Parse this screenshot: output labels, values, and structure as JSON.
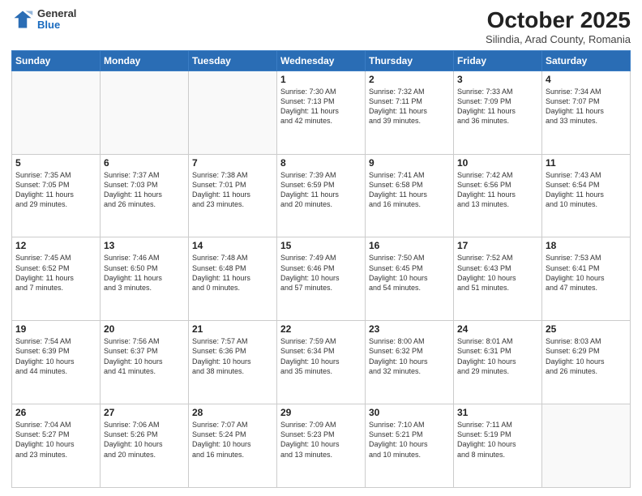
{
  "header": {
    "logo_general": "General",
    "logo_blue": "Blue",
    "month_title": "October 2025",
    "subtitle": "Silindia, Arad County, Romania"
  },
  "weekdays": [
    "Sunday",
    "Monday",
    "Tuesday",
    "Wednesday",
    "Thursday",
    "Friday",
    "Saturday"
  ],
  "weeks": [
    [
      {
        "day": "",
        "info": ""
      },
      {
        "day": "",
        "info": ""
      },
      {
        "day": "",
        "info": ""
      },
      {
        "day": "1",
        "info": "Sunrise: 7:30 AM\nSunset: 7:13 PM\nDaylight: 11 hours\nand 42 minutes."
      },
      {
        "day": "2",
        "info": "Sunrise: 7:32 AM\nSunset: 7:11 PM\nDaylight: 11 hours\nand 39 minutes."
      },
      {
        "day": "3",
        "info": "Sunrise: 7:33 AM\nSunset: 7:09 PM\nDaylight: 11 hours\nand 36 minutes."
      },
      {
        "day": "4",
        "info": "Sunrise: 7:34 AM\nSunset: 7:07 PM\nDaylight: 11 hours\nand 33 minutes."
      }
    ],
    [
      {
        "day": "5",
        "info": "Sunrise: 7:35 AM\nSunset: 7:05 PM\nDaylight: 11 hours\nand 29 minutes."
      },
      {
        "day": "6",
        "info": "Sunrise: 7:37 AM\nSunset: 7:03 PM\nDaylight: 11 hours\nand 26 minutes."
      },
      {
        "day": "7",
        "info": "Sunrise: 7:38 AM\nSunset: 7:01 PM\nDaylight: 11 hours\nand 23 minutes."
      },
      {
        "day": "8",
        "info": "Sunrise: 7:39 AM\nSunset: 6:59 PM\nDaylight: 11 hours\nand 20 minutes."
      },
      {
        "day": "9",
        "info": "Sunrise: 7:41 AM\nSunset: 6:58 PM\nDaylight: 11 hours\nand 16 minutes."
      },
      {
        "day": "10",
        "info": "Sunrise: 7:42 AM\nSunset: 6:56 PM\nDaylight: 11 hours\nand 13 minutes."
      },
      {
        "day": "11",
        "info": "Sunrise: 7:43 AM\nSunset: 6:54 PM\nDaylight: 11 hours\nand 10 minutes."
      }
    ],
    [
      {
        "day": "12",
        "info": "Sunrise: 7:45 AM\nSunset: 6:52 PM\nDaylight: 11 hours\nand 7 minutes."
      },
      {
        "day": "13",
        "info": "Sunrise: 7:46 AM\nSunset: 6:50 PM\nDaylight: 11 hours\nand 3 minutes."
      },
      {
        "day": "14",
        "info": "Sunrise: 7:48 AM\nSunset: 6:48 PM\nDaylight: 11 hours\nand 0 minutes."
      },
      {
        "day": "15",
        "info": "Sunrise: 7:49 AM\nSunset: 6:46 PM\nDaylight: 10 hours\nand 57 minutes."
      },
      {
        "day": "16",
        "info": "Sunrise: 7:50 AM\nSunset: 6:45 PM\nDaylight: 10 hours\nand 54 minutes."
      },
      {
        "day": "17",
        "info": "Sunrise: 7:52 AM\nSunset: 6:43 PM\nDaylight: 10 hours\nand 51 minutes."
      },
      {
        "day": "18",
        "info": "Sunrise: 7:53 AM\nSunset: 6:41 PM\nDaylight: 10 hours\nand 47 minutes."
      }
    ],
    [
      {
        "day": "19",
        "info": "Sunrise: 7:54 AM\nSunset: 6:39 PM\nDaylight: 10 hours\nand 44 minutes."
      },
      {
        "day": "20",
        "info": "Sunrise: 7:56 AM\nSunset: 6:37 PM\nDaylight: 10 hours\nand 41 minutes."
      },
      {
        "day": "21",
        "info": "Sunrise: 7:57 AM\nSunset: 6:36 PM\nDaylight: 10 hours\nand 38 minutes."
      },
      {
        "day": "22",
        "info": "Sunrise: 7:59 AM\nSunset: 6:34 PM\nDaylight: 10 hours\nand 35 minutes."
      },
      {
        "day": "23",
        "info": "Sunrise: 8:00 AM\nSunset: 6:32 PM\nDaylight: 10 hours\nand 32 minutes."
      },
      {
        "day": "24",
        "info": "Sunrise: 8:01 AM\nSunset: 6:31 PM\nDaylight: 10 hours\nand 29 minutes."
      },
      {
        "day": "25",
        "info": "Sunrise: 8:03 AM\nSunset: 6:29 PM\nDaylight: 10 hours\nand 26 minutes."
      }
    ],
    [
      {
        "day": "26",
        "info": "Sunrise: 7:04 AM\nSunset: 5:27 PM\nDaylight: 10 hours\nand 23 minutes."
      },
      {
        "day": "27",
        "info": "Sunrise: 7:06 AM\nSunset: 5:26 PM\nDaylight: 10 hours\nand 20 minutes."
      },
      {
        "day": "28",
        "info": "Sunrise: 7:07 AM\nSunset: 5:24 PM\nDaylight: 10 hours\nand 16 minutes."
      },
      {
        "day": "29",
        "info": "Sunrise: 7:09 AM\nSunset: 5:23 PM\nDaylight: 10 hours\nand 13 minutes."
      },
      {
        "day": "30",
        "info": "Sunrise: 7:10 AM\nSunset: 5:21 PM\nDaylight: 10 hours\nand 10 minutes."
      },
      {
        "day": "31",
        "info": "Sunrise: 7:11 AM\nSunset: 5:19 PM\nDaylight: 10 hours\nand 8 minutes."
      },
      {
        "day": "",
        "info": ""
      }
    ]
  ]
}
